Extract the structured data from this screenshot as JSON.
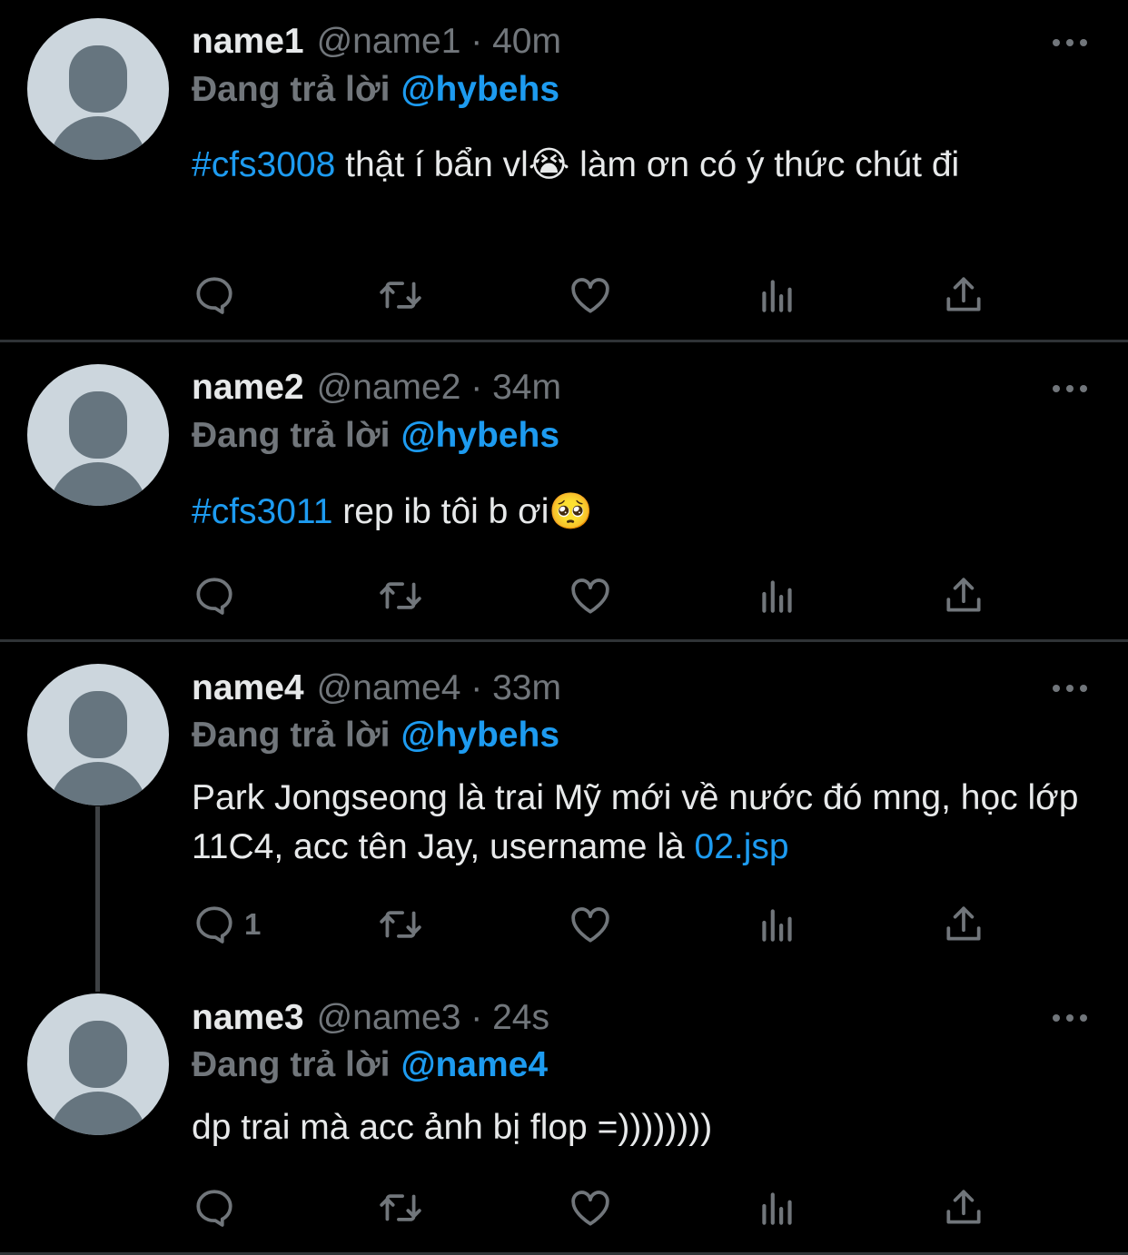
{
  "tweets": [
    {
      "name": "name1",
      "handle": "@name1",
      "time": "40m",
      "reply_prefix": "Đang trả lời",
      "reply_to": "@hybehs",
      "hashtag": "#cfs3008",
      "text": " thật í bẩn vl😭 làm ơn có ý thức chút đi",
      "reply_count": ""
    },
    {
      "name": "name2",
      "handle": "@name2",
      "time": "34m",
      "reply_prefix": "Đang trả lời",
      "reply_to": "@hybehs",
      "hashtag": "#cfs3011",
      "text": " rep ib tôi b ơi🥺",
      "reply_count": ""
    },
    {
      "name": "name4",
      "handle": "@name4",
      "time": "33m",
      "reply_prefix": "Đang trả lời",
      "reply_to": "@hybehs",
      "text": "Park Jongseong là trai Mỹ mới về nước đó mng, học lớp 11C4, acc tên Jay, username là ",
      "link": "02.jsp",
      "reply_count": "1"
    },
    {
      "name": "name3",
      "handle": "@name3",
      "time": "24s",
      "reply_prefix": "Đang trả lời",
      "reply_to": "@name4",
      "text": "dp trai mà acc ảnh bị flop =))))))))",
      "reply_count": ""
    }
  ],
  "icons": {
    "reply": "reply-icon",
    "retweet": "retweet-icon",
    "like": "heart-icon",
    "views": "analytics-icon",
    "share": "share-icon",
    "more": "more-icon"
  },
  "colors": {
    "background": "#000000",
    "text": "#e7e9ea",
    "secondary": "#71767b",
    "accent": "#1d9bf0",
    "divider": "#2f3336",
    "avatar_bg": "#ccd6dd",
    "avatar_fg": "#66757f"
  }
}
